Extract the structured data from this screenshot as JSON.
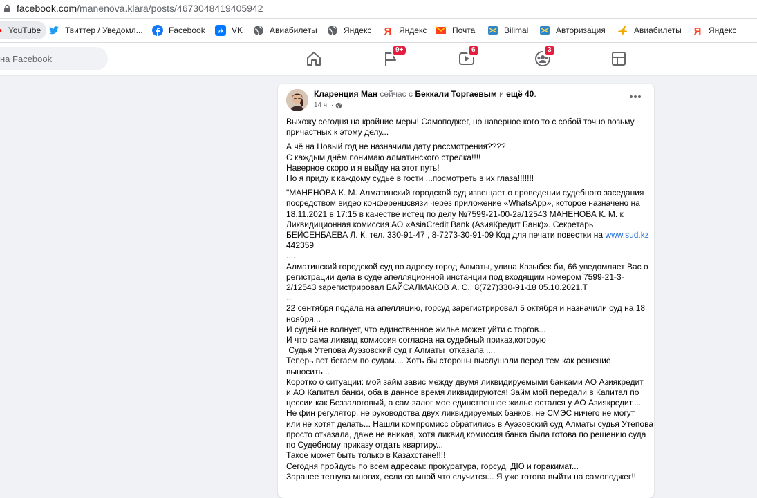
{
  "browser": {
    "url_host": "facebook.com",
    "url_path": "/manenova.klara/posts/4673048419405942"
  },
  "bookmarks": [
    {
      "label": "YouTube",
      "icon": "youtube-icon"
    },
    {
      "label": "Твиттер / Уведомл...",
      "icon": "twitter-icon"
    },
    {
      "label": "Facebook",
      "icon": "facebook-icon"
    },
    {
      "label": "VK",
      "icon": "vk-icon"
    },
    {
      "label": "Авиабилеты",
      "icon": "globe-icon"
    },
    {
      "label": "Яндекс",
      "icon": "globe-icon"
    },
    {
      "label": "Яндекс",
      "icon": "yandex-icon"
    },
    {
      "label": "Почта",
      "icon": "mail-icon"
    },
    {
      "label": "Bilimal",
      "icon": "bilimal-icon"
    },
    {
      "label": "Авторизация",
      "icon": "bilimal-icon"
    },
    {
      "label": "Авиабилеты",
      "icon": "plane-icon"
    },
    {
      "label": "Яндекс",
      "icon": "yandex-icon"
    }
  ],
  "header": {
    "search_placeholder": "на Facebook",
    "nav": [
      {
        "name": "home",
        "badge": ""
      },
      {
        "name": "pages",
        "badge": "9+"
      },
      {
        "name": "watch",
        "badge": "6"
      },
      {
        "name": "groups",
        "badge": "3"
      },
      {
        "name": "gaming",
        "badge": ""
      }
    ]
  },
  "post": {
    "author": "Кларенция Ман",
    "connector1": "сейчас с",
    "tagged": "Беккали Торгаевым",
    "connector2": "и",
    "others": "ещё 40",
    "time": "14 ч.",
    "paragraphs": [
      [
        "Выхожу сегодня на крайние меры! Самоподжег, но наверное кого то с собой точно возьму",
        "причастных к этому делу..."
      ],
      [
        "А чё на Новый год не назначили дату рассмотрения????",
        "С каждым днём понимаю алматинского стрелка!!!!",
        "Наверное скоро и я выйду на этот путь!",
        "Но я приду к каждому судье в гости ...посмотреть в их глаза!!!!!!!"
      ],
      [
        "\"МАНЕНОВА К. М. Алматинский городской суд извещает о проведении судебного заседания",
        "посредством видео конференцсвязи через приложение «WhatsApp», которое назначено на",
        "18.11.2021 в 17:15 в качестве истец по делу №7599-21-00-2а/12543 МАНЕНОВА К. М. к",
        "Ликвидиционная комиссия АО «AsiaCredit Bank (АзияКредит Банк)». Секретарь"
      ]
    ],
    "secretary_line": "БЕЙСЕНБАЕВА Л. К. тел. 330-91-47 , 8-7273-30-91-09 Код для печати повестки на",
    "link": "www.sud.kz",
    "lines_after": [
      "442359",
      "....",
      "Алматинский городской суд по адресу город Алматы, улица Казыбек би, 66 уведомляет Вас о",
      "регистрации дела в суде апелляционной инстанции под входящим номером 7599-21-3-",
      "2/12543 зарегистрировал БАЙСАЛМАКОВ А. С., 8(727)330-91-18 05.10.2021.Т",
      "...",
      "22 сентября подала на апелляцию, горсуд зарегистрировал 5 октября и назначили суд на 18",
      "ноября...",
      "И судей не волнует, что единственное жилье может уйти с торгов...",
      "И что сама ликвид комиссия согласна на судебный приказ,которую",
      " Судья Утепова Ауэзовский суд г Алматы  отказала ....",
      "Теперь вот бегаем по судам.... Хоть бы стороны выслушали перед тем как решение",
      "выносить...",
      "Коротко о ситуации: мой займ завис между двумя ликвидируемыми банками АО Азиякредит",
      "и АО Капитал банки, оба в данное время ликвидируются! Займ мой передали в Капитал по",
      "цессии как Беззалоговый, а сам залог мое единственное жилье остался у АО Азиякредит....",
      "Не фин регулятор, не руководства двух ликвидируемых банков, не СМЭС ничего не могут",
      "или не хотят делать... Нашли компромисс обратились в Ауэзовский суд Алматы судья Утепова",
      "просто отказала, даже не вникая, хотя ликвид комиссия банка была готова по решению суда",
      "по Судебному приказу отдать квартиру...",
      "Такое может быть только в Казахстане!!!!",
      "Сегодня пройдусь по всем адресам: прокуратура, горсуд, ДЮ и горакимат...",
      "Заранее тегнула многих, если со мной что случится... Я уже готова выйти на самоподжег!!"
    ]
  }
}
